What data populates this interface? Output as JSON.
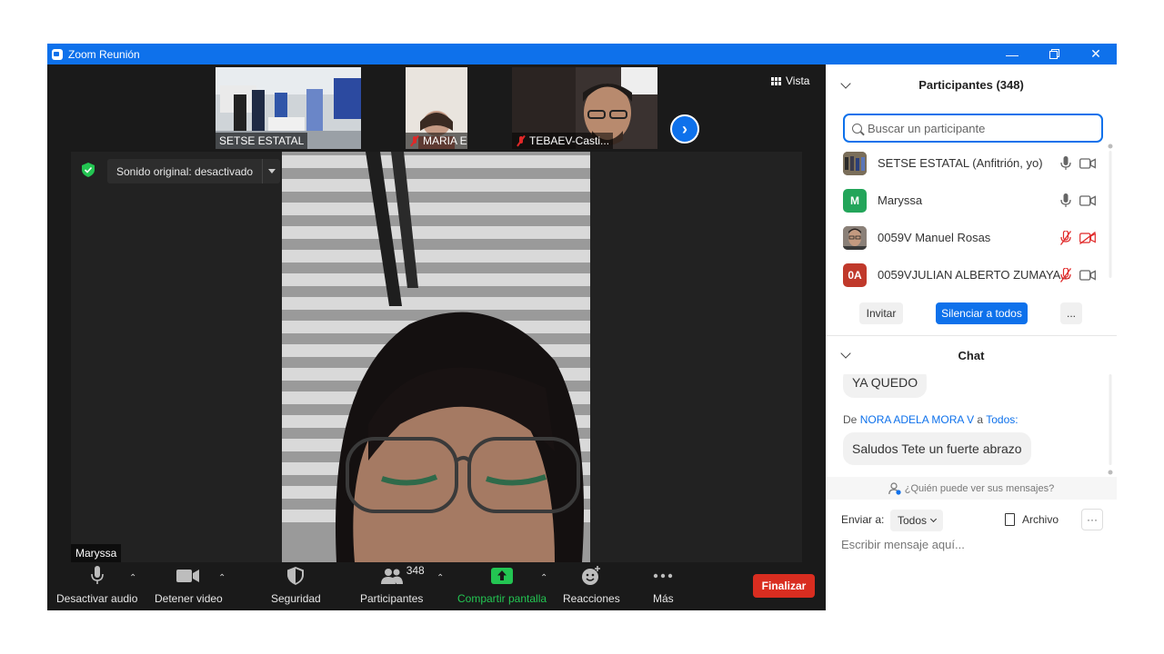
{
  "window": {
    "title": "Zoom Reunión",
    "controls": [
      "minimize-icon",
      "restore-icon",
      "close-icon"
    ]
  },
  "stage": {
    "view_label": "Vista",
    "thumbnails": [
      {
        "name": "SETSE ESTATAL",
        "muted": false
      },
      {
        "name": "MARIA ESTH...",
        "muted": true
      },
      {
        "name": "TEBAEV-Casti...",
        "muted": true
      }
    ],
    "sound_label": "Sonido original: desactivado",
    "main_speaker": "Maryssa"
  },
  "toolbar": {
    "audio": "Desactivar audio",
    "video": "Detener video",
    "security": "Seguridad",
    "participants": "Participantes",
    "participants_count": "348",
    "share": "Compartir pantalla",
    "reactions": "Reacciones",
    "more": "Más",
    "end": "Finalizar"
  },
  "participants_panel": {
    "title": "Participantes (348)",
    "search_placeholder": "Buscar un participante",
    "items": [
      {
        "name": "SETSE ESTATAL (Anfitrión, yo)",
        "avatar": "",
        "avatar_color": "#5a5040",
        "mic_muted": false,
        "cam_off": false
      },
      {
        "name": "Maryssa",
        "avatar": "M",
        "avatar_color": "#23a55a",
        "mic_muted": false,
        "cam_off": false
      },
      {
        "name": "0059V Manuel Rosas",
        "avatar": "",
        "avatar_color": "#6b5a4a",
        "mic_muted": true,
        "cam_off": true
      },
      {
        "name": "0059VJULIAN ALBERTO ZUMAYA...",
        "avatar": "0A",
        "avatar_color": "#c0392b",
        "mic_muted": true,
        "cam_off": false
      }
    ],
    "invite": "Invitar",
    "mute_all": "Silenciar a todos",
    "more": "..."
  },
  "chat": {
    "title": "Chat",
    "messages": [
      {
        "text": "YA QUEDO"
      },
      {
        "from_prefix": "De",
        "from": "NORA ADELA MORA V",
        "to_prefix": "a",
        "to": "Todos:",
        "text": "Saludos Tete un fuerte abrazo"
      }
    ],
    "who_can_see": "¿Quién puede ver sus mensajes?",
    "send_to_label": "Enviar a:",
    "send_to_value": "Todos",
    "file_label": "Archivo",
    "more": "···",
    "input_placeholder": "Escribir mensaje aquí..."
  },
  "colors": {
    "zoom_blue": "#0e71eb",
    "end_red": "#d92d20",
    "share_green": "#23c552",
    "mute_red": "#e02828"
  }
}
